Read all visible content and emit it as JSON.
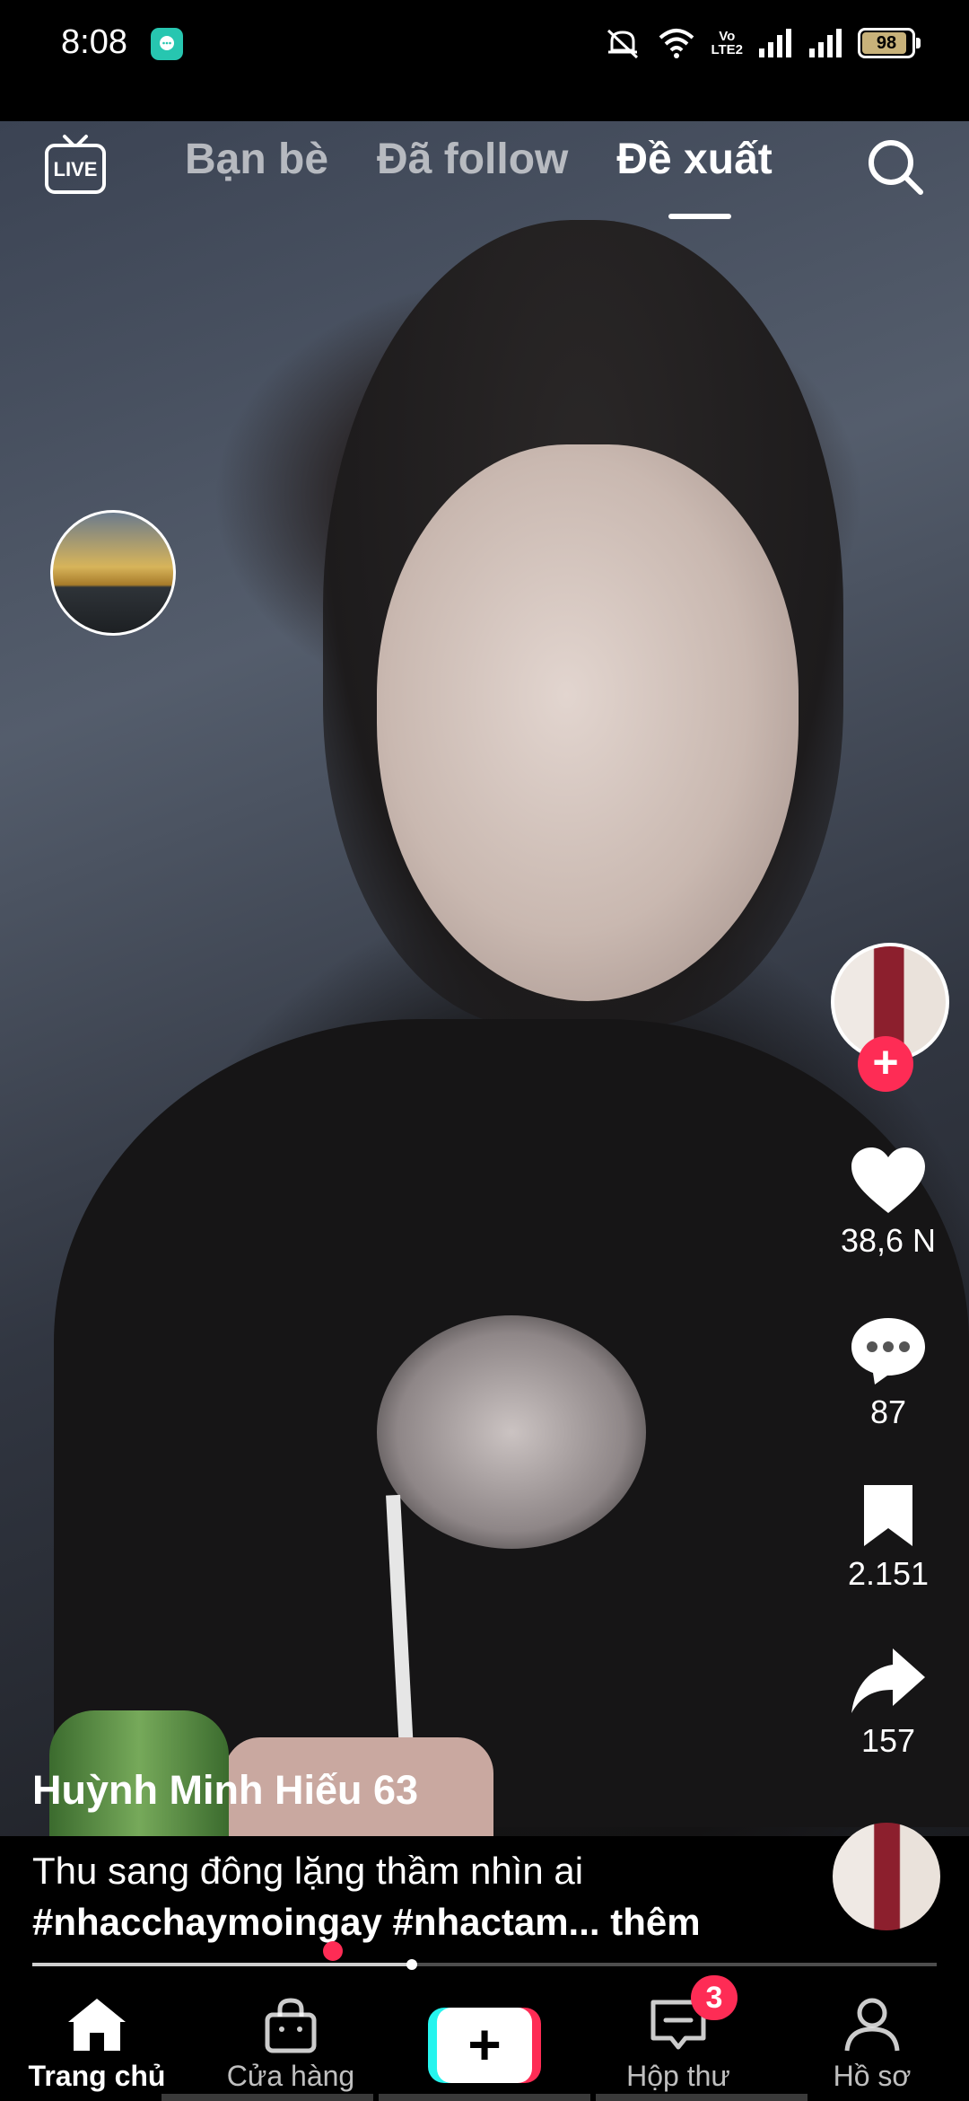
{
  "status": {
    "time": "8:08",
    "battery": "98",
    "network_label": "VoLTE2"
  },
  "top": {
    "tabs": [
      {
        "label": "Bạn bè",
        "active": false
      },
      {
        "label": "Đã follow",
        "active": false
      },
      {
        "label": "Đề xuất",
        "active": true
      }
    ],
    "live_icon": "live-tv-icon",
    "search_icon": "search-icon"
  },
  "rail": {
    "likes": "38,6 N",
    "comments": "87",
    "saves": "2.151",
    "shares": "157"
  },
  "post": {
    "username": "Huỳnh Minh Hiếu 63",
    "caption_line1": "Thu sang đông lặng thầm nhìn ai",
    "caption_line2": "#nhacchaymoingay #nhactam...",
    "more": " thêm",
    "progress": 0.42
  },
  "nav": {
    "home": "Trang chủ",
    "shop": "Cửa hàng",
    "inbox": "Hộp thư",
    "inbox_badge": "3",
    "profile": "Hồ sơ"
  },
  "colors": {
    "accent": "#fe2c55",
    "cyan": "#25f4ee"
  }
}
